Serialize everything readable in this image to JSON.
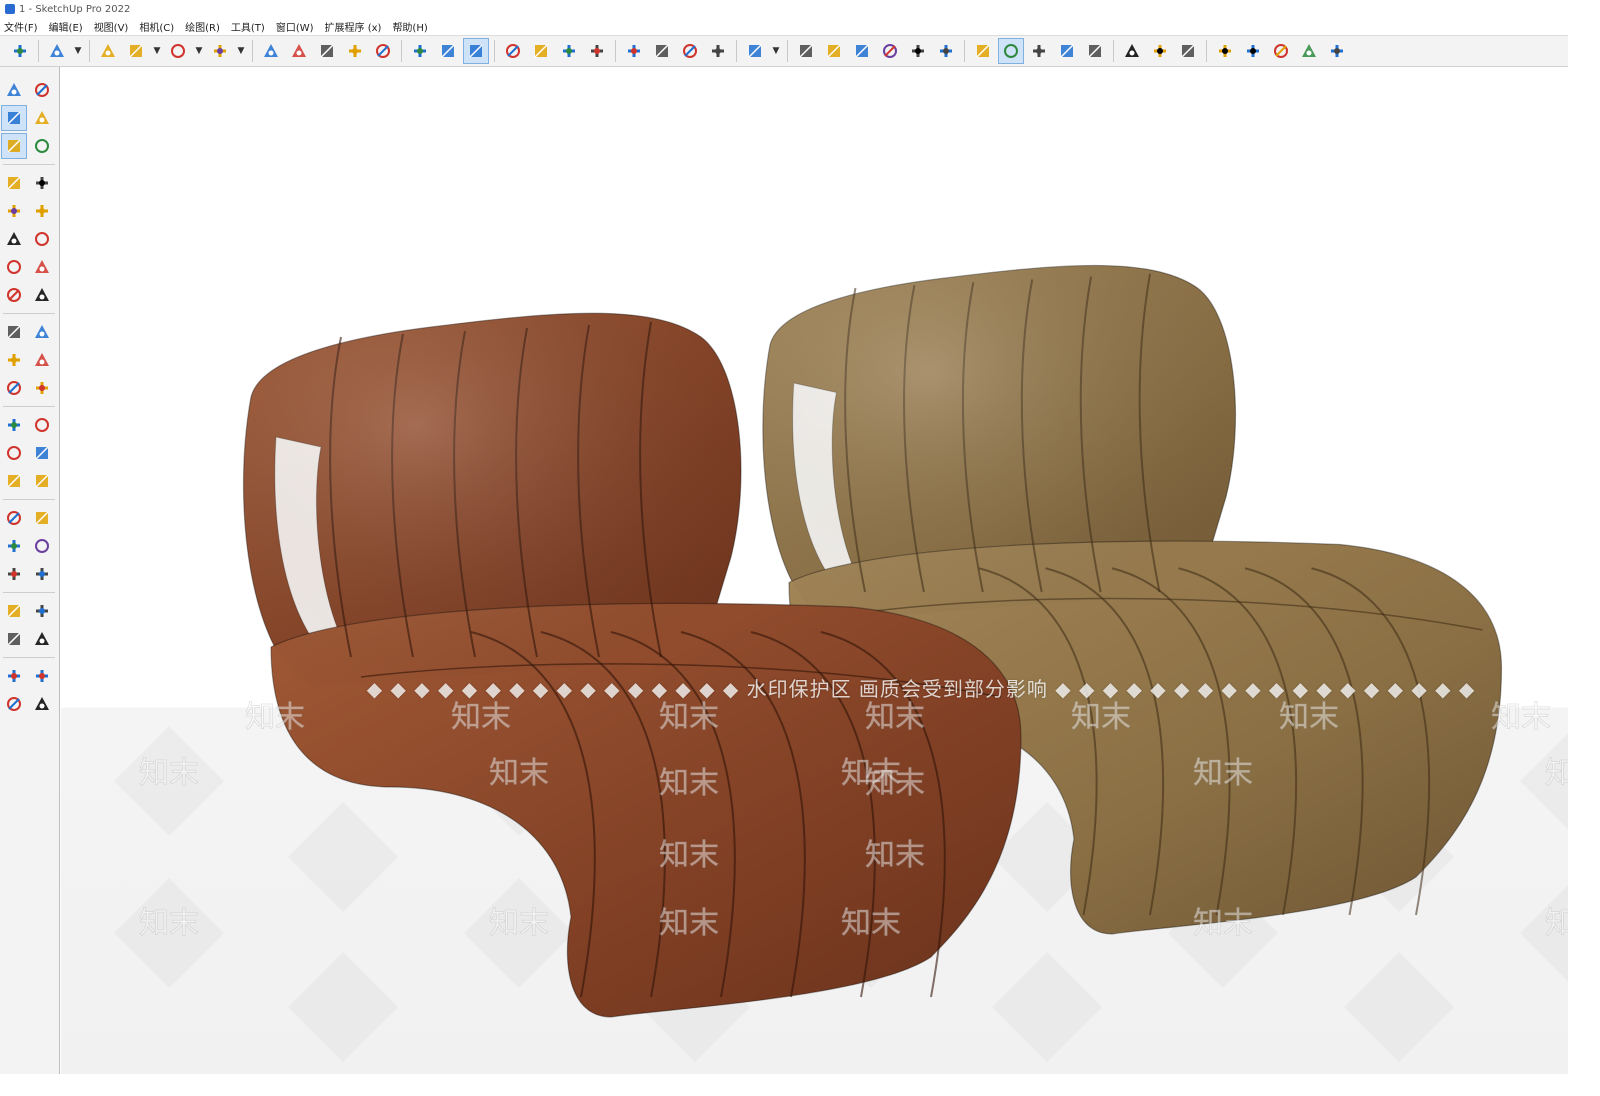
{
  "window": {
    "title": "1 - SketchUp Pro 2022"
  },
  "menu": [
    "文件(F)",
    "编辑(E)",
    "视图(V)",
    "相机(C)",
    "绘图(R)",
    "工具(T)",
    "窗口(W)",
    "扩展程序 (x)",
    "帮助(H)"
  ],
  "toolbar": {
    "icons": [
      "zoom-icon",
      "select-icon",
      "eraser-icon",
      "pencil-icon",
      "arc-icon",
      "rectangle-icon",
      "push-pull-icon",
      "follow-me-icon",
      "move-icon",
      "rotate-icon",
      "scale-icon",
      "tape-measure-icon",
      "text-icon",
      "paint-bucket-icon",
      "orbit-icon",
      "pan-icon",
      "zoom-icon",
      "zoom-extents-icon",
      "warehouse-icon",
      "extension-warehouse-icon",
      "layout-icon",
      "send-to-layout-icon",
      "account-icon",
      "iso-view-icon",
      "top-view-icon",
      "front-view-icon",
      "right-view-icon",
      "back-view-icon",
      "left-view-icon",
      "solid-tools-icon",
      "outer-shell-icon",
      "scenes-icon",
      "add-location-icon",
      "geo-icon",
      "photo-texture-icon",
      "texture-icon",
      "cloud-icon",
      "settings-icon",
      "share-icon",
      "info-icon",
      "cart-icon",
      "user-icon"
    ],
    "active": [
      "paint-bucket-icon",
      "outer-shell-icon"
    ]
  },
  "lefttools": {
    "icons": [
      "select-icon",
      "orbit-icon",
      "paint-bucket-icon",
      "eraser-icon",
      "component-icon",
      "tag-icon",
      "pencil-icon",
      "freehand-icon",
      "rectangle-icon",
      "rotated-rectangle-icon",
      "circle-icon",
      "polygon-icon",
      "arc-icon",
      "two-point-arc-icon",
      "three-point-arc-icon",
      "pie-icon",
      "move-icon",
      "push-pull-icon",
      "rotate-icon",
      "follow-me-icon",
      "scale-icon",
      "offset-icon",
      "tape-measure-icon",
      "dimension-icon",
      "protractor-icon",
      "text-icon",
      "axes-icon",
      "3d-text-icon",
      "orbit-icon",
      "pan-icon",
      "zoom-icon",
      "zoom-window-icon",
      "zoom-extents-icon",
      "previous-view-icon",
      "position-camera-icon",
      "look-around-icon",
      "walk-icon",
      "section-plane-icon",
      "warehouse-icon",
      "extension-icon",
      "layout-icon",
      "send-icon"
    ],
    "active": [
      "paint-bucket-icon",
      "component-icon"
    ]
  },
  "viewport": {
    "watermark_line": "◆ ◆ ◆ ◆ ◆ ◆ ◆ ◆ ◆ ◆ ◆ ◆ ◆ ◆ ◆ ◆  水印保护区   画质会受到部分影响  ◆ ◆ ◆ ◆ ◆ ◆ ◆ ◆ ◆ ◆ ◆ ◆ ◆ ◆ ◆ ◆ ◆ ◆",
    "watermark_mark": "知末",
    "colors": {
      "brown_chair": "#8a4a2c",
      "tan_chair": "#8f7448"
    }
  }
}
